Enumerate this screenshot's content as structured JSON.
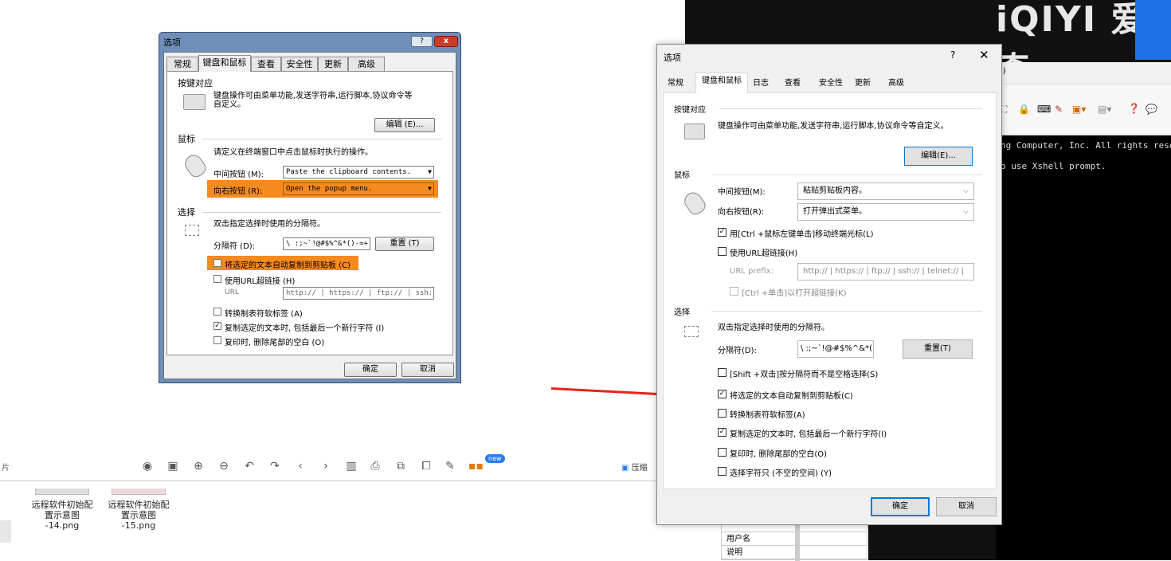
{
  "viewer": {
    "side_char": "片",
    "new_badge": "new",
    "compress_label": "压缩",
    "thumbs": [
      {
        "name": "远程软件初始配置示意图-14.png",
        "l1": "远程软件初始配",
        "l2": "置示意图",
        "l3": "-14.png"
      },
      {
        "name": "远程软件初始配置示意图-15.png",
        "l1": "远程软件初始配",
        "l2": "置示意图",
        "l3": "-15.png"
      }
    ]
  },
  "background_app": {
    "brand": "iQIYI 爱奇",
    "terminal_lines": [
      "ng Computer, Inc. All rights reserv",
      "o use Xshell prompt."
    ],
    "xshell_frag": "l)",
    "table_rows": [
      "用户名",
      "说明"
    ]
  },
  "old_dialog": {
    "title": "选项",
    "help": "?",
    "close": "x",
    "tabs": [
      "常规",
      "键盘和鼠标",
      "查看",
      "安全性",
      "更新",
      "高级"
    ],
    "keymap_section": "按键对应",
    "keymap_desc1": "键盘操作可由菜单功能,发送字符串,运行脚本,协议命令等",
    "keymap_desc2": "自定义。",
    "edit_button": "编辑 (E)...",
    "mouse_section": "鼠标",
    "mouse_desc": "请定义在终端窗口中点击鼠标时执行的操作。",
    "middle_label": "中间按钮 (M):",
    "middle_value": "Paste the clipboard contents.",
    "right_label": "向右按钮 (R):",
    "right_value": "Open the popup menu.",
    "select_section": "选择",
    "select_desc": "双击指定选择时使用的分隔符。",
    "delim_label": "分隔符 (D):",
    "delim_value": "\\ :;~`!@#$%^&*()-=+|",
    "reset_button": "重置 (T)",
    "auto_copy": "将选定的文本自动复制到剪贴板 (C)",
    "use_url": "使用URL超链接 (H)",
    "url_label": "URL",
    "url_value": "http:// | https:// | ftp:// | ssh:/",
    "tab_convert": "转换制表符软标签 (A)",
    "copy_newline": "复制选定的文本时, 包括最后一个新行字符 (I)",
    "trim_trailing": "复印时, 删除尾部的空白 (O)",
    "ok": "确定",
    "cancel": "取消",
    "checked": {
      "auto_copy": false,
      "use_url": false,
      "tab_convert": false,
      "copy_newline": true,
      "trim_trailing": false
    }
  },
  "new_dialog": {
    "title": "选项",
    "help": "?",
    "close": "✕",
    "tabs": [
      "常规",
      "键盘和鼠标",
      "日志",
      "查看",
      "安全性",
      "更新",
      "高级"
    ],
    "keymap_section": "按键对应",
    "keymap_desc": "键盘操作可由菜单功能,发送字符串,运行脚本,协议命令等自定义。",
    "edit_button": "编辑(E)...",
    "mouse_section": "鼠标",
    "middle_label": "中间按钮(M):",
    "middle_value": "粘贴剪贴板内容。",
    "right_label": "向右按钮(R):",
    "right_value": "打开弹出式菜单。",
    "ctrl_click": "用[Ctrl +鼠标左键单击]移动终端光标(L)",
    "use_url": "使用URL超链接(H)",
    "url_prefix_label": "URL prefix:",
    "url_prefix_value": "http:// | https:// | ftp:// | ssh:// | telnet:// |",
    "ctrl_click_url": "[Ctrl +单击]以打开超链接(K)",
    "select_section": "选择",
    "select_desc": "双击指定选择时使用的分隔符。",
    "delim_label": "分隔符(D):",
    "delim_value": "\\ :;~`!@#$%^&*()-=+|[",
    "reset_button": "重置(T)",
    "shift_dbl": "[Shift +双击]按分隔符而不是空格选择(S)",
    "auto_copy": "将选定的文本自动复制到剪贴板(C)",
    "tab_convert": "转换制表符软标签(A)",
    "copy_newline": "复制选定的文本时, 包括最后一个新行字符(I)",
    "trim_trailing": "复印时, 删除尾部的空白(O)",
    "select_nonblank": "选择字符只 (不空的空间) (Y)",
    "ok": "确定",
    "cancel": "取消",
    "checked": {
      "ctrl_click": true,
      "use_url": false,
      "ctrl_click_url": false,
      "shift_dbl": false,
      "auto_copy": true,
      "tab_convert": false,
      "copy_newline": true,
      "trim_trailing": false,
      "select_nonblank": false
    }
  },
  "colors": {
    "highlight": "#f58a1f",
    "arrow": "#e8231a",
    "accent": "#0078d7"
  }
}
